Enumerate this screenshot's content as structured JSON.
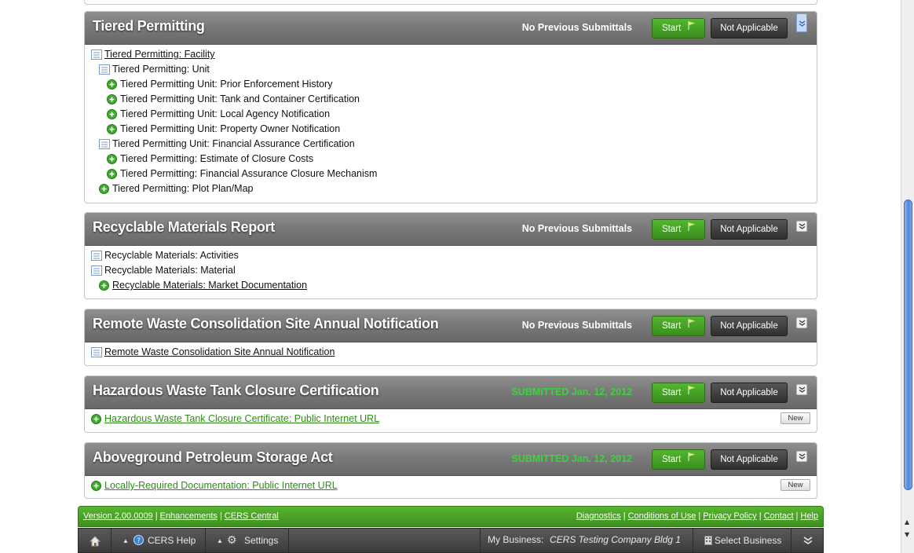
{
  "sections": [
    {
      "title": "Tiered Permitting",
      "status": "No Previous Submittals",
      "start_label": "Start",
      "na_label": "Not Applicable",
      "items": [
        {
          "label": "Tiered Permitting: Facility",
          "icon": "document-icon",
          "link": true
        },
        {
          "label": "Tiered Permitting: Unit",
          "icon": "document-icon",
          "link": false
        },
        {
          "label": "Tiered Permitting Unit: Prior Enforcement History",
          "icon": "add-icon",
          "link": false
        },
        {
          "label": "Tiered Permitting Unit: Tank and Container Certification",
          "icon": "add-icon",
          "link": false
        },
        {
          "label": "Tiered Permitting Unit: Local Agency Notification",
          "icon": "add-icon",
          "link": false
        },
        {
          "label": "Tiered Permitting Unit: Property Owner Notification",
          "icon": "add-icon",
          "link": false
        },
        {
          "label": "Tiered Permitting Unit: Financial Assurance Certification",
          "icon": "document-icon",
          "link": false
        },
        {
          "label": "Tiered Permitting: Estimate of Closure Costs",
          "icon": "add-icon",
          "link": false
        },
        {
          "label": "Tiered Permitting: Financial Assurance Closure Mechanism",
          "icon": "add-icon",
          "link": false
        },
        {
          "label": "Tiered Permitting: Plot Plan/Map",
          "icon": "add-icon",
          "link": false
        }
      ]
    },
    {
      "title": "Recyclable Materials Report",
      "status": "No Previous Submittals",
      "start_label": "Start",
      "na_label": "Not Applicable",
      "items": [
        {
          "label": "Recyclable Materials: Activities",
          "icon": "document-icon",
          "link": false
        },
        {
          "label": "Recyclable Materials: Material",
          "icon": "document-icon",
          "link": false
        },
        {
          "label": "Recyclable Materials: Market Documentation",
          "icon": "add-icon",
          "link": true
        }
      ]
    },
    {
      "title": "Remote Waste Consolidation Site Annual Notification",
      "status": "No Previous Submittals",
      "start_label": "Start",
      "na_label": "Not Applicable",
      "items": [
        {
          "label": "Remote Waste Consolidation Site Annual Notification",
          "icon": "document-icon",
          "link": true
        }
      ]
    },
    {
      "title": "Hazardous Waste Tank Closure Certification",
      "status": "SUBMITTED Jan. 12, 2012",
      "start_label": "Start",
      "na_label": "Not Applicable",
      "items": [
        {
          "label": "Hazardous Waste Tank Closure Certificate: Public Internet URL",
          "icon": "add-icon",
          "link": true,
          "new_label": "New"
        }
      ]
    },
    {
      "title": "Aboveground Petroleum Storage Act",
      "status": "SUBMITTED Jan. 12, 2012",
      "start_label": "Start",
      "na_label": "Not Applicable",
      "items": [
        {
          "label": "Locally-Required Documentation: Public Internet URL",
          "icon": "add-icon",
          "link": true,
          "new_label": "New"
        }
      ]
    }
  ],
  "footer": {
    "left_links": [
      "Version 2.00.0009",
      "Enhancements",
      "CERS Central"
    ],
    "right_links": [
      "Diagnostics",
      "Conditions of Use",
      "Privacy Policy",
      "Contact",
      "Help"
    ]
  },
  "bottom_bar": {
    "help_label": "CERS Help",
    "settings_label": "Settings",
    "business_prefix": "My Business:",
    "business_name": "CERS Testing Company Bldg 1",
    "select_business_label": "Select Business"
  },
  "colors": {
    "header_gray": "#7a7a7a",
    "start_green": "#47a326",
    "submitted_green": "#3cd33c",
    "footer_green": "#4ea628",
    "link_green": "#2e8b17"
  }
}
